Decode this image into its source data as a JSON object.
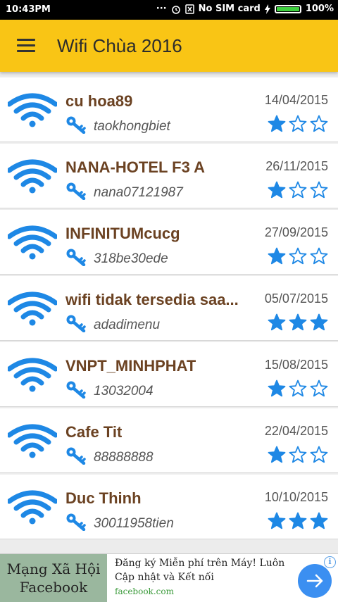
{
  "status_bar": {
    "time": "10:43PM",
    "sim": "No SIM card",
    "battery": "100%",
    "icons": [
      "dots-icon",
      "alarm-icon",
      "sim-x-icon",
      "charging-icon",
      "battery-icon"
    ]
  },
  "app_bar": {
    "title": "Wifi Chùa 2016",
    "menu_icon": "menu-icon"
  },
  "networks": [
    {
      "ssid": "cu hoa89",
      "password": "taokhongbiet",
      "date": "14/04/2015",
      "rating": 1
    },
    {
      "ssid": "NANA-HOTEL F3 A",
      "password": "nana07121987",
      "date": "26/11/2015",
      "rating": 1
    },
    {
      "ssid": "INFINITUMcucg",
      "password": "318be30ede",
      "date": "27/09/2015",
      "rating": 1
    },
    {
      "ssid": "wifi tidak tersedia saa...",
      "password": "adadimenu",
      "date": "05/07/2015",
      "rating": 3
    },
    {
      "ssid": "VNPT_MINHPHAT",
      "password": "13032004",
      "date": "15/08/2015",
      "rating": 1
    },
    {
      "ssid": "Cafe Tit",
      "password": "88888888",
      "date": "22/04/2015",
      "rating": 1
    },
    {
      "ssid": "Duc Thinh",
      "password": "30011958tien",
      "date": "10/10/2015",
      "rating": 3
    }
  ],
  "ad": {
    "logo_line1": "Mạng Xã Hội",
    "logo_line2": "Facebook",
    "text": "Đăng ký Miễn phí trên Máy! Luôn Cập nhật và Kết nối",
    "url": "facebook.com",
    "info": "i"
  },
  "colors": {
    "app_bar": "#f9c515",
    "accent_blue": "#1e88e5",
    "ssid_brown": "#6b4222"
  }
}
